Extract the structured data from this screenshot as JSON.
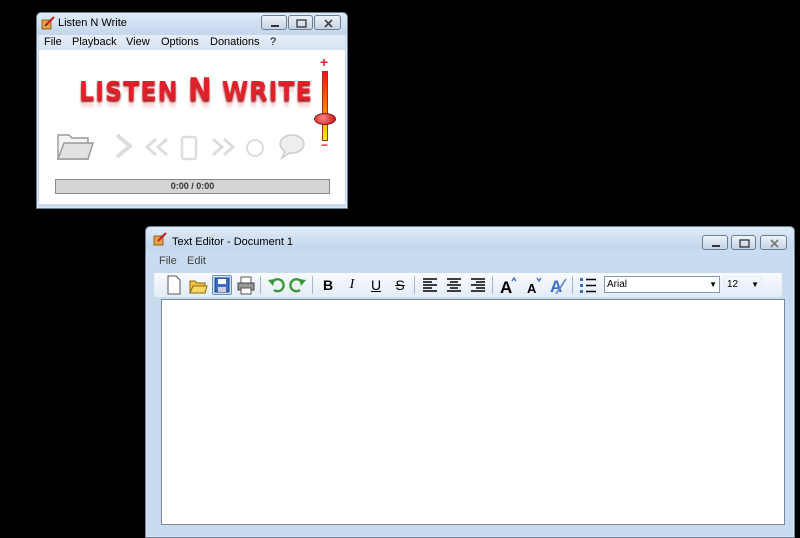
{
  "lnw": {
    "title": "Listen N Write",
    "menu": [
      "File",
      "Playback",
      "View",
      "Options",
      "Donations",
      "?"
    ],
    "logo_part1": "LISTEN ",
    "logo_part2": "N",
    "logo_part3": " WRITE",
    "volume_plus": "+",
    "volume_minus": "−",
    "volume_level": 0.3,
    "time_display": "0:00 / 0:00",
    "progress": 0
  },
  "editor": {
    "title": "Text Editor - Document 1",
    "menu": [
      "File",
      "Edit"
    ],
    "bold": "B",
    "italic": "I",
    "underline": "U",
    "strike": "S",
    "font_name": "Arial",
    "font_size": "12",
    "text": ""
  },
  "colors": {
    "accent_red": "#e0202a",
    "title_blue": "#c9dcef"
  }
}
